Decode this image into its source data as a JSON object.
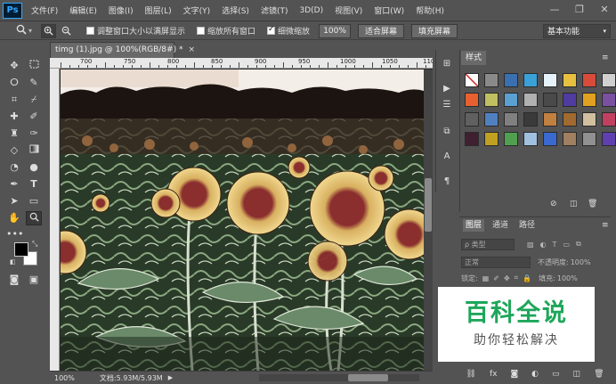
{
  "app": {
    "logo": "Ps"
  },
  "menu": [
    "文件(F)",
    "编辑(E)",
    "图像(I)",
    "图层(L)",
    "文字(Y)",
    "选择(S)",
    "滤镜(T)",
    "3D(D)",
    "视图(V)",
    "窗口(W)",
    "帮助(H)"
  ],
  "window_controls": {
    "minimize": "—",
    "restore": "❐",
    "close": "✕"
  },
  "options": {
    "resize_windows": "调整窗口大小以满屏显示",
    "zoom_all": "缩放所有窗口",
    "scrubby_zoom": "细微缩放",
    "zoom_value": "100%",
    "fit_screen": "适合屏幕",
    "fill_screen": "填充屏幕",
    "workspace": "基本功能"
  },
  "document": {
    "tab_title": "timg (1).jpg @ 100%(RGB/8#) *",
    "tab_close": "×",
    "ruler_ticks": [
      "700",
      "750",
      "800",
      "850",
      "900",
      "950",
      "1000",
      "1050",
      "1100"
    ]
  },
  "status": {
    "zoom": "100%",
    "doc_size": "文档:5.93M/5.93M"
  },
  "styles_panel": {
    "tab": "样式",
    "swatch_colors": [
      [
        "#ffffff",
        "#8a8a8a",
        "#3a6fb0",
        "#3aa0d8",
        "#e6f2fa",
        "#e8c040",
        "#d84a3a",
        "#d0d0d0"
      ],
      [
        "#e86030",
        "#c0c060",
        "#5aa0d0",
        "#b0b0b0",
        "#4a4a4a",
        "#503ca0",
        "#e0a020",
        "#7a50a0"
      ],
      [
        "#606060",
        "#5080c0",
        "#808080",
        "#3a3a3a",
        "#c08040",
        "#a06a30",
        "#d0c0a0",
        "#c04060"
      ],
      [
        "#402030",
        "#c0a020",
        "#50a050",
        "#a0c0e0",
        "#3a6ad0",
        "#a08060",
        "#909090",
        "#6040b0"
      ]
    ]
  },
  "layers_panel": {
    "tabs": [
      "图层",
      "通道",
      "路径"
    ],
    "kind_filter": "ρ 类型",
    "blend_mode": "正常",
    "opacity_label": "不透明度:",
    "opacity_value": "100%",
    "lock_label": "锁定:",
    "fill_label": "填充:",
    "fill_value": "100%"
  },
  "watermark": {
    "title": "百科全说",
    "subtitle": "助你轻松解决"
  }
}
